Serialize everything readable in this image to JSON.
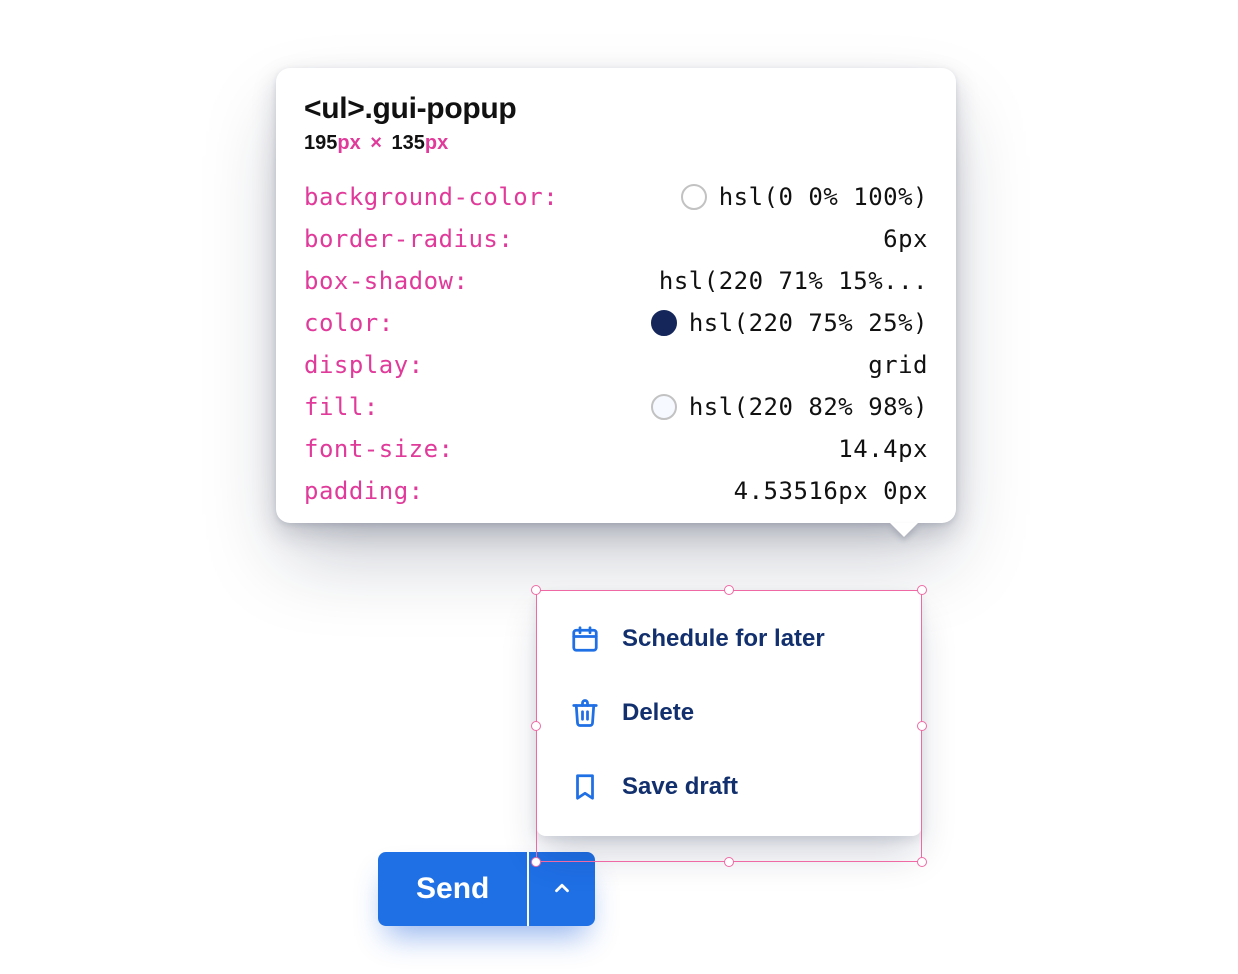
{
  "tooltip": {
    "selector_tag": "<ul>",
    "selector_class": ".gui-popup",
    "dims": {
      "width": "195",
      "times": "×",
      "height": "135",
      "unit": "px"
    },
    "props": [
      {
        "key": "background-color",
        "swatch": "white",
        "value": "hsl(0 0% 100%)"
      },
      {
        "key": "border-radius",
        "value": "6px"
      },
      {
        "key": "box-shadow",
        "value": "hsl(220 71% 15%..."
      },
      {
        "key": "color",
        "swatch": "navy",
        "value": "hsl(220 75% 25%)"
      },
      {
        "key": "display",
        "value": "grid"
      },
      {
        "key": "fill",
        "swatch": "pale",
        "value": "hsl(220 82% 98%)"
      },
      {
        "key": "font-size",
        "value": "14.4px"
      },
      {
        "key": "padding",
        "value": "4.53516px 0px"
      }
    ]
  },
  "popup": {
    "items": [
      {
        "icon": "calendar-icon",
        "label": "Schedule for later"
      },
      {
        "icon": "trash-icon",
        "label": "Delete"
      },
      {
        "icon": "bookmark-icon",
        "label": "Save draft"
      }
    ]
  },
  "send": {
    "label": "Send"
  }
}
